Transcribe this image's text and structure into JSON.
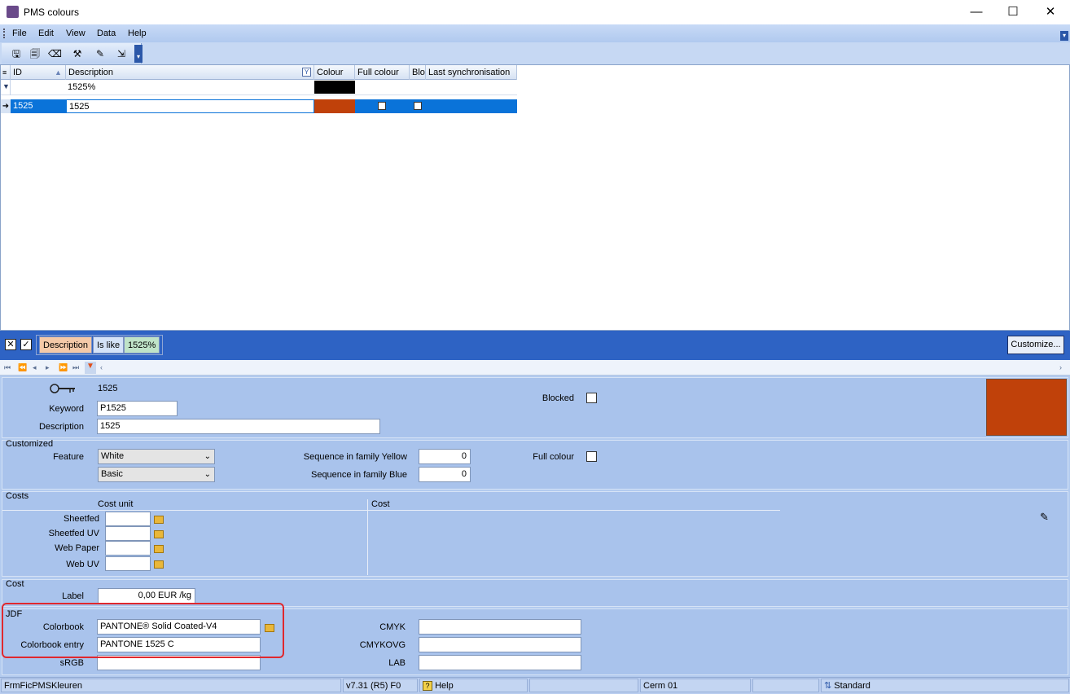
{
  "window": {
    "title": "PMS colours",
    "minimize": "—",
    "maximize": "☐",
    "close": "✕"
  },
  "menu": [
    "File",
    "Edit",
    "View",
    "Data",
    "Help"
  ],
  "grid": {
    "headers": {
      "id": "ID",
      "description": "Description",
      "colour": "Colour",
      "full_colour": "Full colour",
      "blo": "Blo",
      "last_sync": "Last synchronisation"
    },
    "filter": {
      "description": "1525%",
      "colour_hex": "#000000"
    },
    "row": {
      "id": "1525",
      "description": "1525",
      "colour_hex": "#c0410a",
      "full_colour": false,
      "blocked": false
    }
  },
  "filterbar": {
    "field": "Description",
    "operator": "Is like",
    "value": "1525%",
    "customize": "Customize..."
  },
  "record": {
    "id": "1525",
    "keyword_label": "Keyword",
    "keyword": "P1525",
    "description_label": "Description",
    "description": "1525",
    "blocked_label": "Blocked",
    "swatch_hex": "#c0410a"
  },
  "customized": {
    "title": "Customized",
    "feature_label": "Feature",
    "feature1": "White",
    "feature2": "Basic",
    "seq_yellow_label": "Sequence in family Yellow",
    "seq_yellow": "0",
    "seq_blue_label": "Sequence in family Blue",
    "seq_blue": "0",
    "full_colour_label": "Full colour"
  },
  "costs": {
    "title": "Costs",
    "cost_unit_header": "Cost unit",
    "cost_header": "Cost",
    "rows": [
      "Sheetfed",
      "Sheetfed UV",
      "Web Paper",
      "Web UV"
    ]
  },
  "cost": {
    "title": "Cost",
    "label_label": "Label",
    "label_value": "0,00 EUR /kg"
  },
  "jdf": {
    "title": "JDF",
    "colorbook_label": "Colorbook",
    "colorbook": "PANTONE® Solid Coated-V4",
    "entry_label": "Colorbook entry",
    "entry": "PANTONE 1525 C",
    "srgb_label": "sRGB",
    "cmyk_label": "CMYK",
    "cmykovg_label": "CMYKOVG",
    "lab_label": "LAB"
  },
  "status": {
    "form": "FrmFicPMSKleuren",
    "version": "v7.31 (R5) F0",
    "help": "Help",
    "company": "Cerm 01",
    "mode": "Standard"
  }
}
